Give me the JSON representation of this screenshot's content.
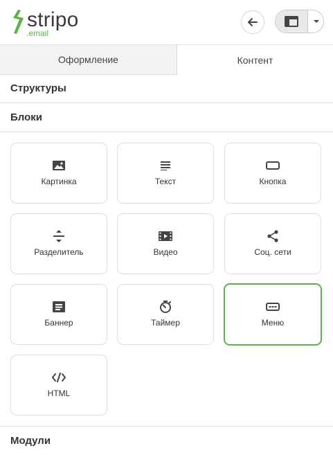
{
  "brand": {
    "name": "stripo",
    "sub": ".email",
    "accent": "#5bb24a"
  },
  "header": {
    "back_icon": "arrow-left-icon",
    "view_icon": "layout-icon",
    "dropdown_icon": "caret-down-icon"
  },
  "tabs": [
    {
      "label": "Оформление",
      "active": false
    },
    {
      "label": "Контент",
      "active": true
    }
  ],
  "sections": {
    "structures": "Структуры",
    "blocks": "Блоки",
    "modules": "Модули"
  },
  "blocks": [
    {
      "label": "Картинка",
      "icon": "image-icon"
    },
    {
      "label": "Текст",
      "icon": "text-icon"
    },
    {
      "label": "Кнопка",
      "icon": "button-icon"
    },
    {
      "label": "Разделитель",
      "icon": "divider-icon"
    },
    {
      "label": "Видео",
      "icon": "video-icon"
    },
    {
      "label": "Соц. сети",
      "icon": "share-icon"
    },
    {
      "label": "Баннер",
      "icon": "banner-icon"
    },
    {
      "label": "Таймер",
      "icon": "timer-icon"
    },
    {
      "label": "Меню",
      "icon": "menu-icon",
      "selected": true
    },
    {
      "label": "HTML",
      "icon": "code-icon"
    }
  ]
}
